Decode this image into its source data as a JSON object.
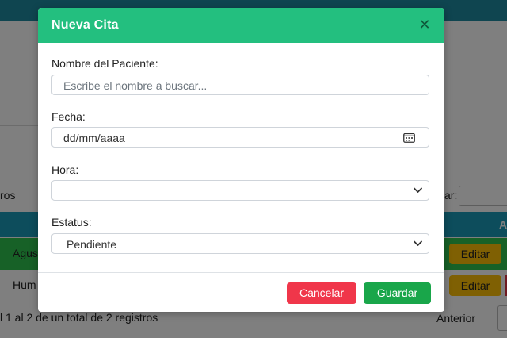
{
  "background": {
    "label_left_ros": "ros",
    "label_search": "ar:",
    "row1_name": "Agus",
    "row2_name": "Hum",
    "edit_label": "Editar",
    "table_header_fragment": "A",
    "footer_info": "l 1 al 2 de un total de 2 registros",
    "prev_label": "Anterior"
  },
  "modal": {
    "title": "Nueva Cita",
    "close_icon": "close-icon",
    "patient": {
      "label": "Nombre del Paciente:",
      "placeholder": "Escribe el nombre a buscar..."
    },
    "date": {
      "label": "Fecha:",
      "value": "dd/mm/aaaa",
      "icon": "calendar-icon"
    },
    "time": {
      "label": "Hora:",
      "value": ""
    },
    "status": {
      "label": "Estatus:",
      "value": "Pendiente"
    },
    "buttons": {
      "cancel": "Cancelar",
      "save": "Guardar"
    }
  },
  "colors": {
    "header": "#23bf7f",
    "cancel": "#f0364a",
    "save": "#19a64a",
    "edit": "#ffc107"
  }
}
